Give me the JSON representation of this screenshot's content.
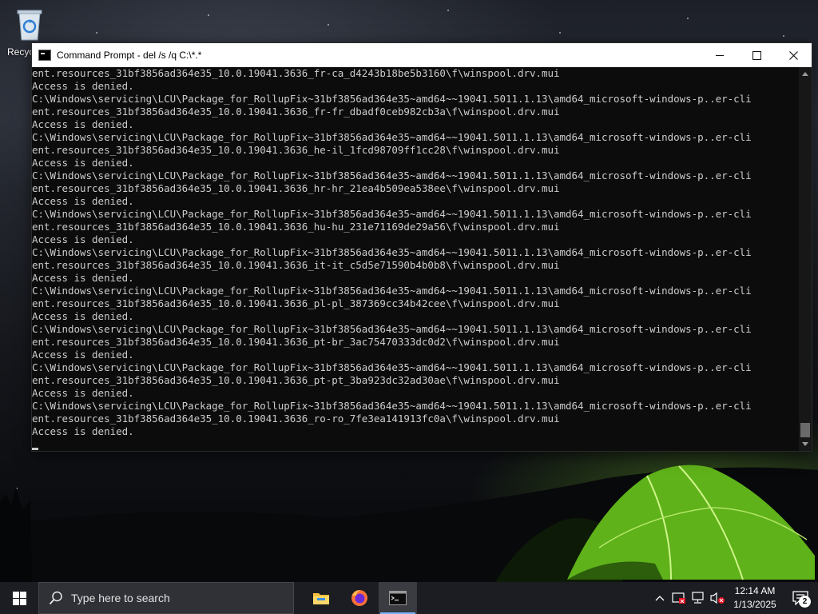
{
  "desktop": {
    "recycle_bin_label": "Recyc"
  },
  "window": {
    "title": "Command Prompt - del  /s /q C:\\*.*",
    "console_lines": [
      "ent.resources_31bf3856ad364e35_10.0.19041.3636_fr-ca_d4243b18be5b3160\\f\\winspool.drv.mui",
      "Access is denied.",
      "C:\\Windows\\servicing\\LCU\\Package_for_RollupFix~31bf3856ad364e35~amd64~~19041.5011.1.13\\amd64_microsoft-windows-p..er-cli",
      "ent.resources_31bf3856ad364e35_10.0.19041.3636_fr-fr_dbadf0ceb982cb3a\\f\\winspool.drv.mui",
      "Access is denied.",
      "C:\\Windows\\servicing\\LCU\\Package_for_RollupFix~31bf3856ad364e35~amd64~~19041.5011.1.13\\amd64_microsoft-windows-p..er-cli",
      "ent.resources_31bf3856ad364e35_10.0.19041.3636_he-il_1fcd98709ff1cc28\\f\\winspool.drv.mui",
      "Access is denied.",
      "C:\\Windows\\servicing\\LCU\\Package_for_RollupFix~31bf3856ad364e35~amd64~~19041.5011.1.13\\amd64_microsoft-windows-p..er-cli",
      "ent.resources_31bf3856ad364e35_10.0.19041.3636_hr-hr_21ea4b509ea538ee\\f\\winspool.drv.mui",
      "Access is denied.",
      "C:\\Windows\\servicing\\LCU\\Package_for_RollupFix~31bf3856ad364e35~amd64~~19041.5011.1.13\\amd64_microsoft-windows-p..er-cli",
      "ent.resources_31bf3856ad364e35_10.0.19041.3636_hu-hu_231e71169de29a56\\f\\winspool.drv.mui",
      "Access is denied.",
      "C:\\Windows\\servicing\\LCU\\Package_for_RollupFix~31bf3856ad364e35~amd64~~19041.5011.1.13\\amd64_microsoft-windows-p..er-cli",
      "ent.resources_31bf3856ad364e35_10.0.19041.3636_it-it_c5d5e71590b4b0b8\\f\\winspool.drv.mui",
      "Access is denied.",
      "C:\\Windows\\servicing\\LCU\\Package_for_RollupFix~31bf3856ad364e35~amd64~~19041.5011.1.13\\amd64_microsoft-windows-p..er-cli",
      "ent.resources_31bf3856ad364e35_10.0.19041.3636_pl-pl_387369cc34b42cee\\f\\winspool.drv.mui",
      "Access is denied.",
      "C:\\Windows\\servicing\\LCU\\Package_for_RollupFix~31bf3856ad364e35~amd64~~19041.5011.1.13\\amd64_microsoft-windows-p..er-cli",
      "ent.resources_31bf3856ad364e35_10.0.19041.3636_pt-br_3ac75470333dc0d2\\f\\winspool.drv.mui",
      "Access is denied.",
      "C:\\Windows\\servicing\\LCU\\Package_for_RollupFix~31bf3856ad364e35~amd64~~19041.5011.1.13\\amd64_microsoft-windows-p..er-cli",
      "ent.resources_31bf3856ad364e35_10.0.19041.3636_pt-pt_3ba923dc32ad30ae\\f\\winspool.drv.mui",
      "Access is denied.",
      "C:\\Windows\\servicing\\LCU\\Package_for_RollupFix~31bf3856ad364e35~amd64~~19041.5011.1.13\\amd64_microsoft-windows-p..er-cli",
      "ent.resources_31bf3856ad364e35_10.0.19041.3636_ro-ro_7fe3ea141913fc0a\\f\\winspool.drv.mui",
      "Access is denied."
    ],
    "colors": {
      "console_bg": "#0c0c0c",
      "console_text": "#cccccc",
      "titlebar_bg": "#ffffff"
    }
  },
  "taskbar": {
    "search_placeholder": "Type here to search",
    "apps": [
      "file-explorer-icon",
      "firefox-icon",
      "command-prompt-icon"
    ],
    "active_app": "command-prompt-icon",
    "clock_time": "12:14 AM",
    "clock_date": "1/13/2025",
    "notification_count": "2",
    "accent": "#78b4ff"
  }
}
